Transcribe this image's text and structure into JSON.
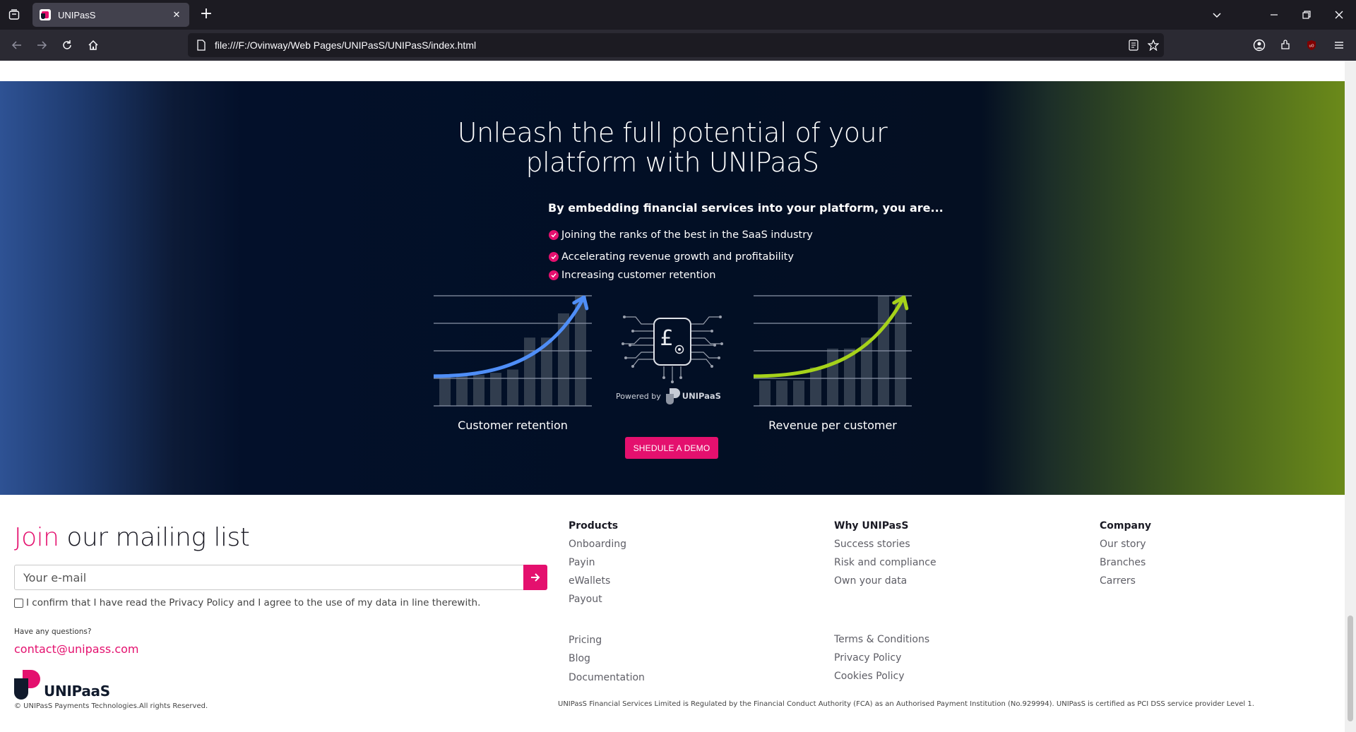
{
  "browser": {
    "tab_title": "UNIPasS",
    "url": "file:///F:/Ovinway/Web Pages/UNIPasS/UNIPasS/index.html"
  },
  "hero": {
    "title_line1": "Unleash the full potential of your",
    "title_line2": "platform with UNIPaaS",
    "subtitle": "By embedding financial services into your platform, you are...",
    "bullets": [
      "Joining the ranks of the best in the SaaS industry",
      "Accelerating revenue growth and profitability",
      "Increasing customer retention"
    ],
    "charts": [
      {
        "label": "Customer retention",
        "accent": "#4f8ef7",
        "bar_levels": [
          0.28,
          0.28,
          0.28,
          0.3,
          0.33,
          0.62,
          0.62,
          0.84,
          1.0
        ]
      },
      {
        "label": "Revenue per customer",
        "accent": "#a6d21a",
        "bar_levels": [
          0.23,
          0.23,
          0.23,
          0.35,
          0.52,
          0.52,
          0.62,
          1.0,
          1.0
        ]
      }
    ],
    "powered_by": "Powered by",
    "powered_brand": "UNIPaaS",
    "cta": "SHEDULE A DEMO"
  },
  "footer": {
    "join_accent": "Join",
    "join_rest": " our mailing list",
    "email_placeholder": "Your e-mail",
    "consent": "I confirm that I have read the Privacy Policy and I agree to the use of my data in line therewith.",
    "questions": "Have any questions?",
    "contact_email": "contact@unipass.com",
    "brand": "UNIPaaS",
    "copyright": "© UNIPasS Payments Technologies.All rights Reserved.",
    "products": {
      "heading": "Products",
      "links": [
        "Onboarding",
        "Payin",
        "eWallets",
        "Payout"
      ],
      "extra_links": [
        "Pricing",
        "Blog",
        "Documentation"
      ]
    },
    "why": {
      "heading": "Why UNIPasS",
      "links": [
        "Success stories",
        "Risk and compliance",
        "Own your data"
      ],
      "extra_links": [
        "Terms & Conditions",
        "Privacy Policy",
        "Cookies Policy"
      ]
    },
    "company": {
      "heading": "Company",
      "links": [
        "Our story",
        "Branches",
        "Carrers"
      ]
    },
    "legal": "UNIPasS Financial Services Limited is Regulated by the Financial Conduct Authority (FCA) as an Authorised Payment Institution (No.929994). UNIPasS is certified as PCI DSS service provider Level 1."
  },
  "colors": {
    "brand_pink": "#e4106e",
    "navy": "#020f25"
  }
}
